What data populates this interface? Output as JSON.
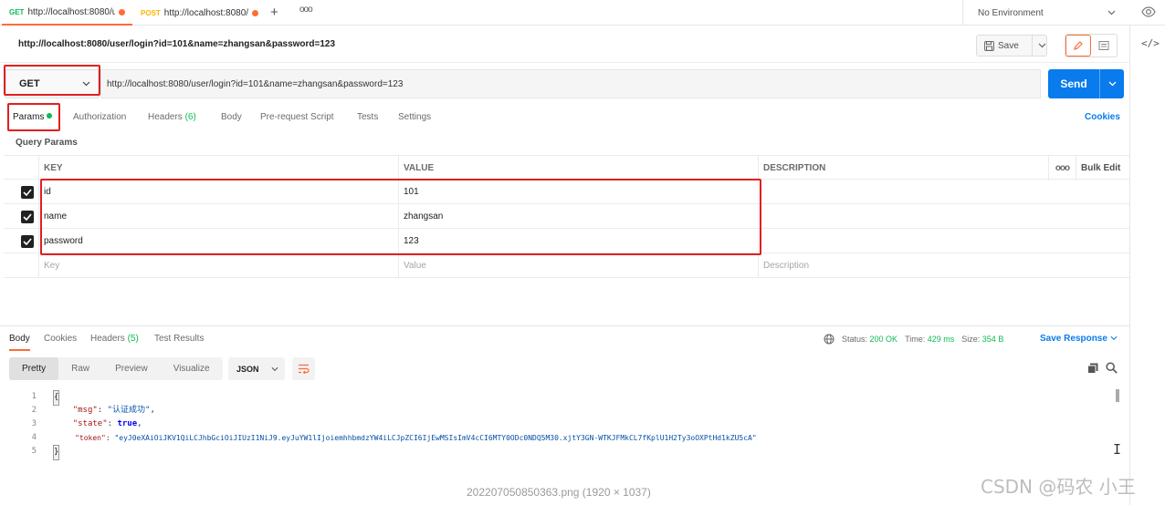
{
  "tabs": [
    {
      "method": "GET",
      "url": "http://localhost:8080/u",
      "active": true
    },
    {
      "method": "POST",
      "url": "http://localhost:8080/",
      "active": false
    }
  ],
  "new_tab_label": "+",
  "more_tabs_label": "ooo",
  "environment": {
    "label": "No Environment"
  },
  "request": {
    "title": "http://localhost:8080/user/login?id=101&name=zhangsan&password=123",
    "save_label": "Save",
    "method": "GET",
    "url": "http://localhost:8080/user/login?id=101&name=zhangsan&password=123",
    "send_label": "Send"
  },
  "request_tabs": [
    {
      "label": "Params",
      "count": ""
    },
    {
      "label": "Authorization",
      "count": ""
    },
    {
      "label": "Headers",
      "count": "(6)"
    },
    {
      "label": "Body",
      "count": ""
    },
    {
      "label": "Pre-request Script",
      "count": ""
    },
    {
      "label": "Tests",
      "count": ""
    },
    {
      "label": "Settings",
      "count": ""
    }
  ],
  "cookies_label": "Cookies",
  "query_params_label": "Query Params",
  "params_table": {
    "headers": {
      "key": "KEY",
      "value": "VALUE",
      "description": "DESCRIPTION",
      "more": "ooo",
      "bulk_edit": "Bulk Edit"
    },
    "rows": [
      {
        "checked": true,
        "key": "id",
        "value": "101",
        "description": ""
      },
      {
        "checked": true,
        "key": "name",
        "value": "zhangsan",
        "description": ""
      },
      {
        "checked": true,
        "key": "password",
        "value": "123",
        "description": ""
      }
    ],
    "placeholder": {
      "key": "Key",
      "value": "Value",
      "description": "Description"
    }
  },
  "response": {
    "tabs": [
      {
        "label": "Body",
        "count": ""
      },
      {
        "label": "Cookies",
        "count": ""
      },
      {
        "label": "Headers",
        "count": "(5)"
      },
      {
        "label": "Test Results",
        "count": ""
      }
    ],
    "status_label": "Status:",
    "status_value": "200 OK",
    "time_label": "Time:",
    "time_value": "429 ms",
    "size_label": "Size:",
    "size_value": "354 B",
    "save_response_label": "Save Response",
    "view_modes": [
      "Pretty",
      "Raw",
      "Preview",
      "Visualize"
    ],
    "format": "JSON",
    "code_lines": [
      {
        "n": "1",
        "text": "{"
      },
      {
        "n": "2",
        "key": "\"msg\"",
        "sep": ": ",
        "val": "\"认证成功\"",
        "end": ","
      },
      {
        "n": "3",
        "key": "\"state\"",
        "sep": ": ",
        "val": "true",
        "end": ","
      },
      {
        "n": "4",
        "key": "\"token\"",
        "sep": ": ",
        "val": "\"eyJ0eXAiOiJKV1QiLCJhbGciOiJIUzI1NiJ9.eyJuYW1lIjoiemhhbmdzYW4iLCJpZCI6IjEwMSIsImV4cCI6MTY0ODc0NDQ5M30.xjtY3GN-WTKJFMkCL7fKplU1H2Ty3oOXPtHd1kZU5cA\"",
        "end": ""
      },
      {
        "n": "5",
        "text": "}"
      }
    ]
  },
  "caption": "20220705085036​3.png (1920 × 1037)",
  "watermark": "CSDN @码农 小王",
  "colors": {
    "accent": "#ff6c37",
    "send": "#097bed",
    "success": "#0cbb52",
    "annotation": "#e02020"
  }
}
